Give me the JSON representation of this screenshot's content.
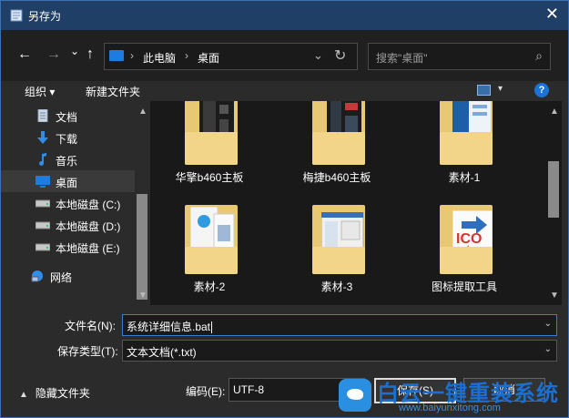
{
  "window": {
    "title": "另存为",
    "close_glyph": "✕"
  },
  "nav": {
    "back_glyph": "←",
    "forward_glyph": "→",
    "recent_glyph": "⌄",
    "up_glyph": "↑",
    "breadcrumb": [
      "此电脑",
      "桌面"
    ],
    "separator": "›",
    "dropdown_glyph": "⌄",
    "refresh_glyph": "↻",
    "search_placeholder": "搜索\"桌面\"",
    "search_icon": "⌕"
  },
  "toolbar": {
    "organize_label": "组织 ▾",
    "new_folder_label": "新建文件夹",
    "view_dropdown": "▾",
    "help_glyph": "?"
  },
  "sidebar": {
    "items": [
      {
        "label": "文档",
        "icon": "document-icon"
      },
      {
        "label": "下载",
        "icon": "download-icon"
      },
      {
        "label": "音乐",
        "icon": "music-icon"
      },
      {
        "label": "桌面",
        "icon": "desktop-icon",
        "selected": true
      },
      {
        "label": "本地磁盘 (C:)",
        "icon": "drive-icon"
      },
      {
        "label": "本地磁盘 (D:)",
        "icon": "drive-icon"
      },
      {
        "label": "本地磁盘 (E:)",
        "icon": "drive-icon"
      },
      {
        "label": "网络",
        "icon": "network-icon"
      }
    ]
  },
  "files": [
    {
      "name": "华擎b460主板"
    },
    {
      "name": "梅捷b460主板"
    },
    {
      "name": "素材-1"
    },
    {
      "name": "素材-2"
    },
    {
      "name": "素材-3"
    },
    {
      "name": "图标提取工具"
    }
  ],
  "scroll_glyphs": {
    "up": "▲",
    "down": "▼"
  },
  "form": {
    "filename_label": "文件名(N):",
    "filename_value": "系统详细信息.bat",
    "filetype_label": "保存类型(T):",
    "filetype_value": "文本文档(*.txt)",
    "dropdown_glyph": "⌄",
    "encoding_label": "编码(E):",
    "encoding_value": "UTF-8",
    "hide_folders_label": "隐藏文件夹",
    "hide_folders_glyph": "▲",
    "save_label": "保存(S)",
    "cancel_label": "取消"
  },
  "watermark": {
    "name": "白云一键重装系统",
    "url": "www.baiyunxitong.com"
  },
  "colors": {
    "accent": "#1a73d9",
    "titlebar": "#1f3f66",
    "folder": "#f3d58a"
  }
}
